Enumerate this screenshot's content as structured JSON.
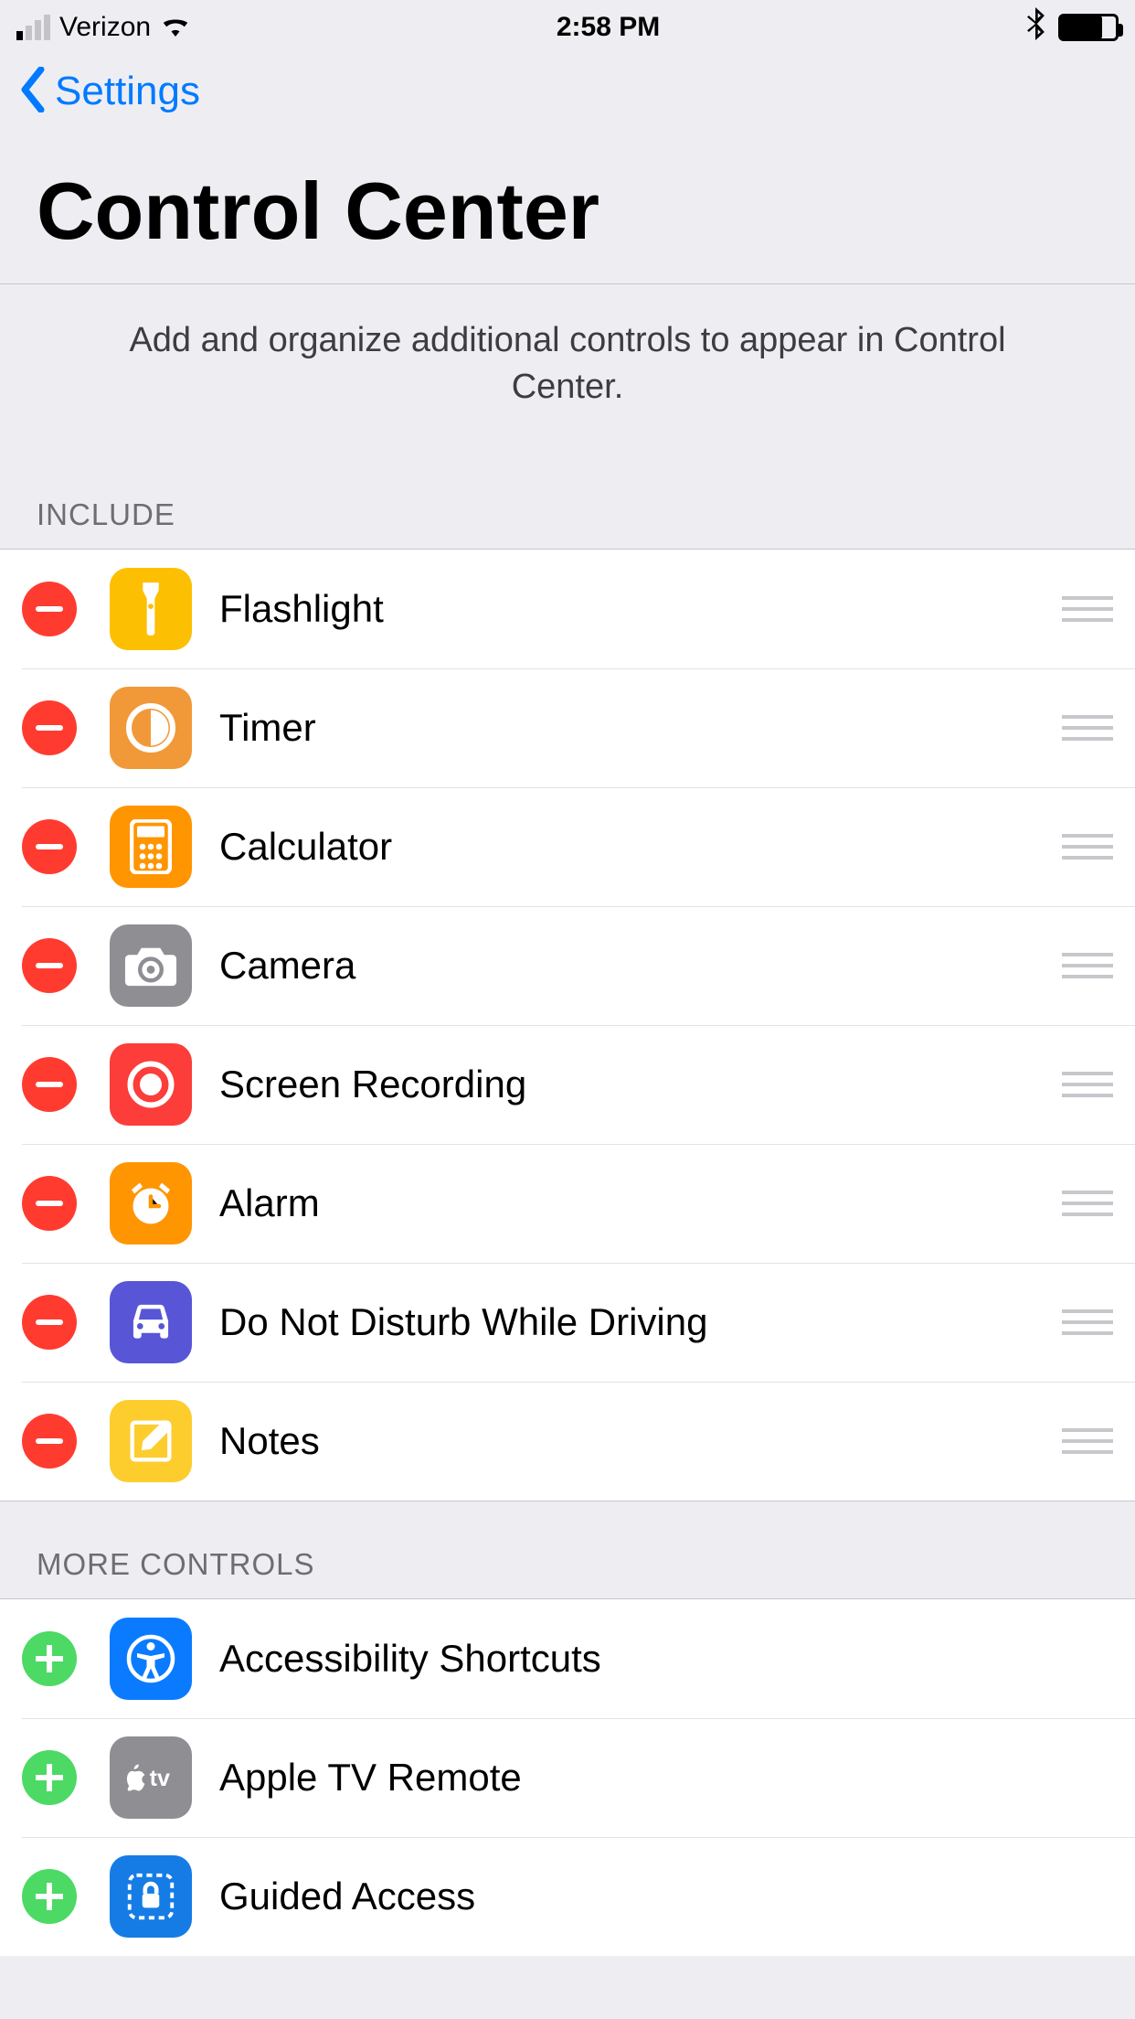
{
  "status": {
    "carrier": "Verizon",
    "time": "2:58 PM"
  },
  "nav": {
    "back_label": "Settings"
  },
  "title": "Control Center",
  "desc": "Add and organize additional controls to appear in Control Center.",
  "sections": {
    "include_header": "Include",
    "more_header": "More Controls"
  },
  "include": [
    {
      "label": "Flashlight"
    },
    {
      "label": "Timer"
    },
    {
      "label": "Calculator"
    },
    {
      "label": "Camera"
    },
    {
      "label": "Screen Recording"
    },
    {
      "label": "Alarm"
    },
    {
      "label": "Do Not Disturb While Driving"
    },
    {
      "label": "Notes"
    }
  ],
  "more": [
    {
      "label": "Accessibility Shortcuts"
    },
    {
      "label": "Apple TV Remote"
    },
    {
      "label": "Guided Access"
    }
  ]
}
